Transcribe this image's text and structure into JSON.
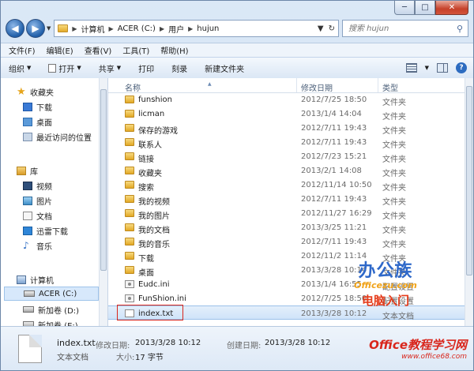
{
  "window": {
    "caption_min": "─",
    "caption_max": "□",
    "caption_close": "✕"
  },
  "address": {
    "back_glyph": "◀",
    "forward_glyph": "▶",
    "crumbs": [
      "计算机",
      "ACER (C:)",
      "用户",
      "hujun"
    ],
    "search_placeholder": "搜索 hujun",
    "refresh_glyph": "↻",
    "dropdown_glyph": "▼",
    "icon": "folder-icon"
  },
  "menu": [
    "文件(F)",
    "编辑(E)",
    "查看(V)",
    "工具(T)",
    "帮助(H)"
  ],
  "toolbar": {
    "organize": "组织",
    "open": "打开",
    "share": "共享",
    "print": "打印",
    "burn": "刻录",
    "new_folder": "新建文件夹"
  },
  "nav": {
    "favorites": {
      "label": "收藏夹",
      "items": [
        "下载",
        "桌面",
        "最近访问的位置"
      ]
    },
    "libraries": {
      "label": "库",
      "items": [
        "视频",
        "图片",
        "文档",
        "迅雷下载",
        "音乐"
      ]
    },
    "computer": {
      "label": "计算机",
      "items": [
        "ACER (C:)",
        "新加卷 (D:)",
        "新加卷 (E:)"
      ]
    }
  },
  "columns": {
    "name": "名称",
    "date": "修改日期",
    "type": "类型"
  },
  "files": [
    {
      "name": "funshion",
      "date": "2012/7/25 18:50",
      "type": "文件夹",
      "kind": "folder"
    },
    {
      "name": "licman",
      "date": "2013/1/4 14:04",
      "type": "文件夹",
      "kind": "folder"
    },
    {
      "name": "保存的游戏",
      "date": "2012/7/11 19:43",
      "type": "文件夹",
      "kind": "folder"
    },
    {
      "name": "联系人",
      "date": "2012/7/11 19:43",
      "type": "文件夹",
      "kind": "folder"
    },
    {
      "name": "链接",
      "date": "2012/7/23 15:21",
      "type": "文件夹",
      "kind": "folder"
    },
    {
      "name": "收藏夹",
      "date": "2013/2/1 14:08",
      "type": "文件夹",
      "kind": "folder"
    },
    {
      "name": "搜索",
      "date": "2012/11/14 10:50",
      "type": "文件夹",
      "kind": "folder"
    },
    {
      "name": "我的视频",
      "date": "2012/7/11 19:43",
      "type": "文件夹",
      "kind": "folder"
    },
    {
      "name": "我的图片",
      "date": "2012/11/27 16:29",
      "type": "文件夹",
      "kind": "folder"
    },
    {
      "name": "我的文档",
      "date": "2013/3/25 11:21",
      "type": "文件夹",
      "kind": "folder"
    },
    {
      "name": "我的音乐",
      "date": "2012/7/11 19:43",
      "type": "文件夹",
      "kind": "folder"
    },
    {
      "name": "下载",
      "date": "2012/11/2 11:14",
      "type": "文件夹",
      "kind": "folder"
    },
    {
      "name": "桌面",
      "date": "2013/3/28 10:14",
      "type": "文件夹",
      "kind": "folder"
    },
    {
      "name": "Eudc.ini",
      "date": "2013/1/4 16:55",
      "type": "配置设置",
      "kind": "ini"
    },
    {
      "name": "FunShion.ini",
      "date": "2012/7/25 18:50",
      "type": "配置设置",
      "kind": "ini"
    },
    {
      "name": "index.txt",
      "date": "2013/3/28 10:12",
      "type": "文本文档",
      "kind": "txt"
    }
  ],
  "details": {
    "name": "index.txt",
    "type": "文本文档",
    "modified_label": "修改日期:",
    "modified_value": "2013/3/28 10:12",
    "created_label": "创建日期:",
    "created_value": "2013/3/28 10:12",
    "size_label": "大小:",
    "size_value": "17 字节"
  },
  "watermarks": {
    "main": "办公族",
    "url": "Officezu.com",
    "sub": "电脑入门",
    "corner": "Office教程学习网",
    "corner_url": "www.office68.com"
  }
}
